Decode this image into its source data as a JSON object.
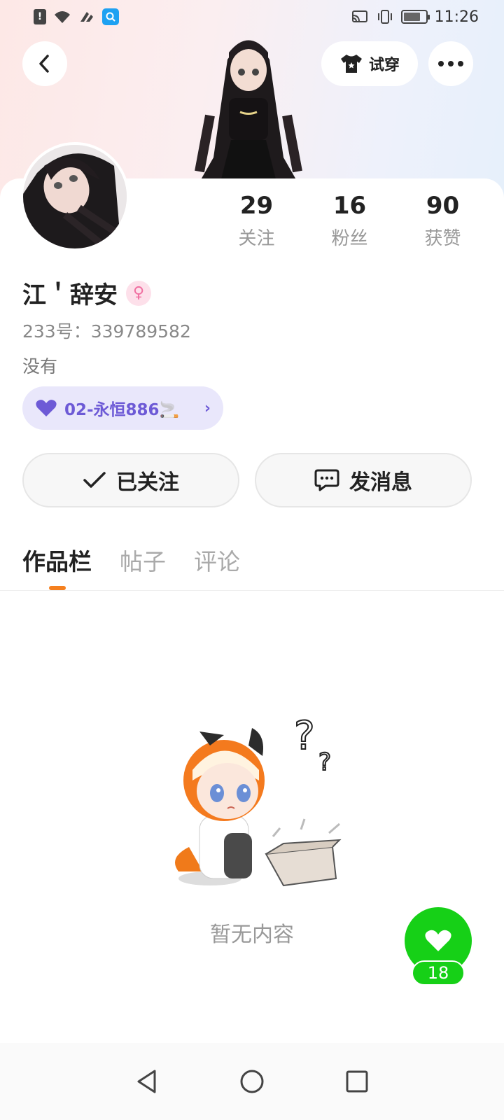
{
  "status_bar": {
    "time": "11:26",
    "left_icons": [
      "notification-icon",
      "wifi-icon",
      "signal-icon",
      "search-app-icon"
    ],
    "right_icons": [
      "cast-icon",
      "vibrate-icon",
      "battery-icon"
    ]
  },
  "header": {
    "try_on_label": "试穿"
  },
  "stats": [
    {
      "value": "29",
      "label": "关注"
    },
    {
      "value": "16",
      "label": "粉丝"
    },
    {
      "value": "90",
      "label": "获赞"
    }
  ],
  "profile": {
    "name": "江＇辞安",
    "id_line": "233号：339789582",
    "bio": "没有",
    "club_badge": "02-永恒886🚬"
  },
  "actions": {
    "follow_label": "已关注",
    "message_label": "发消息"
  },
  "tabs": [
    {
      "label": "作品栏",
      "active": true
    },
    {
      "label": "帖子",
      "active": false
    },
    {
      "label": "评论",
      "active": false
    }
  ],
  "empty_state": {
    "text": "暂无内容"
  },
  "fab": {
    "count": "18"
  },
  "colors": {
    "accent_orange": "#f5801f",
    "fab_green": "#16d017",
    "club_purple": "#6d5ad6"
  }
}
